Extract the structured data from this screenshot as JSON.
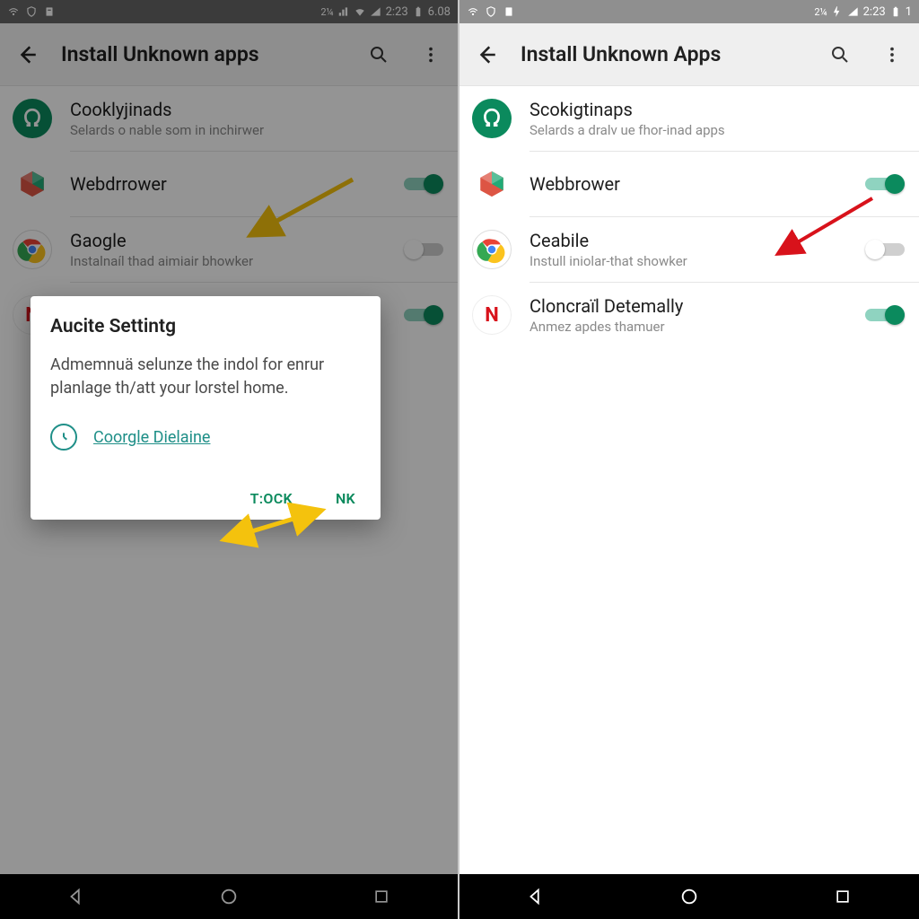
{
  "left": {
    "statusbar": {
      "clock": "2:23",
      "batt": "6.08"
    },
    "header": {
      "title": "Install Unknown apps"
    },
    "apps": [
      {
        "title": "Cooklyjinads",
        "subtitle": "Selards o nable som in inchirwer",
        "iconName": "omega-icon",
        "toggle": null
      },
      {
        "title": "Webdrrower",
        "subtitle": "",
        "iconName": "box-icon",
        "toggle": true
      },
      {
        "title": "Gaogle",
        "subtitle": "Instalnaíl thad aimiair bhowker",
        "iconName": "chrome-icon",
        "toggle": false
      },
      {
        "title": "",
        "subtitle": "",
        "iconName": "netflix-icon",
        "toggle": true
      }
    ],
    "dialog": {
      "title": "Aucite Settintg",
      "body": "Admemnuä selunze the indol for enrur planlage th/att your lorstel home.",
      "linkText": "Coorgle Dielaine",
      "cancel": "T:OCK",
      "ok": "NK"
    }
  },
  "right": {
    "statusbar": {
      "clock": "2:23",
      "batt": "1"
    },
    "header": {
      "title": "Install Unknown Apps"
    },
    "apps": [
      {
        "title": "Scokigtinaps",
        "subtitle": "Selards a dralv ue fhor-inad apps",
        "iconName": "omega-icon",
        "toggle": null
      },
      {
        "title": "Webbrower",
        "subtitle": "",
        "iconName": "box-icon",
        "toggle": true
      },
      {
        "title": "Ceabile",
        "subtitle": "Instull iniolar-that showker",
        "iconName": "chrome-icon",
        "toggle": false
      },
      {
        "title": "Cloncraïl Detemally",
        "subtitle": "Anmez apdes thamuer",
        "iconName": "netflix-icon",
        "toggle": true
      }
    ]
  },
  "colors": {
    "accent": "#0b8a5d"
  }
}
